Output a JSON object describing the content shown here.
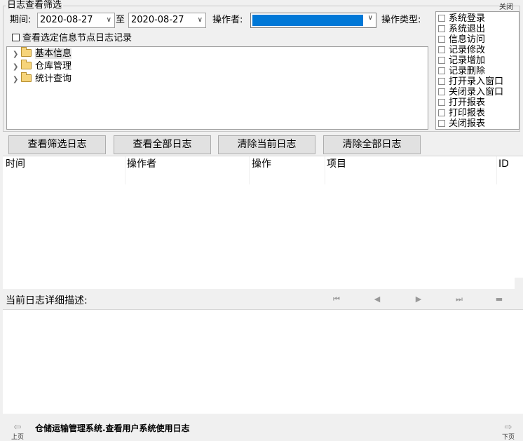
{
  "filter": {
    "title": "日志查看筛选",
    "close": "关闭",
    "period_label": "期间:",
    "date_from": "2020-08-27",
    "to_label": "至",
    "date_to": "2020-08-27",
    "operator_label": "操作者:",
    "optype_label": "操作类型:",
    "selected_node_checkbox": "查看选定信息节点日志记录"
  },
  "tree": {
    "items": [
      {
        "label": "基本信息",
        "selected": true
      },
      {
        "label": "仓库管理",
        "selected": false
      },
      {
        "label": "统计查询",
        "selected": false
      }
    ]
  },
  "op_types": [
    "系统登录",
    "系统退出",
    "信息访问",
    "记录修改",
    "记录增加",
    "记录删除",
    "打开录入窗口",
    "关闭录入窗口",
    "打开报表",
    "打印报表",
    "关闭报表"
  ],
  "buttons": {
    "view_filtered": "查看筛选日志",
    "view_all": "查看全部日志",
    "clear_current": "清除当前日志",
    "clear_all": "清除全部日志"
  },
  "log_table": {
    "columns": [
      "时间",
      "操作者",
      "操作",
      "项目",
      "ID"
    ]
  },
  "detail": {
    "label": "当前日志详细描述:"
  },
  "footer": {
    "prev": "上页",
    "next": "下页",
    "title": "仓储运输管理系统.查看用户系统使用日志"
  },
  "colors": {
    "selection": "#0078d7",
    "folder": "#f6d47a"
  }
}
